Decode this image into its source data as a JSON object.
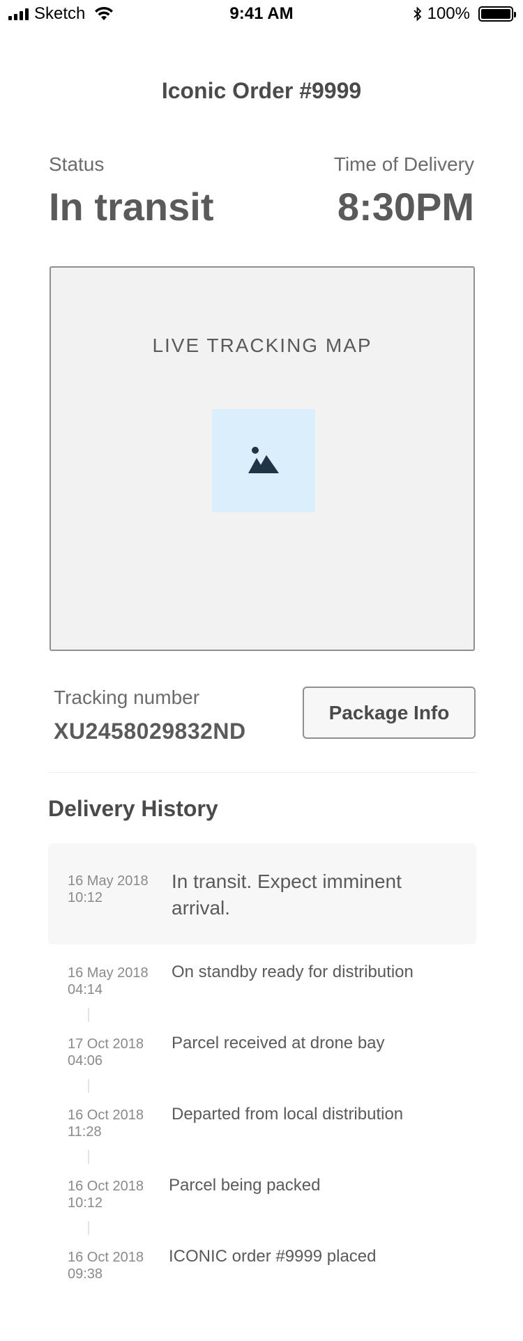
{
  "status_bar": {
    "carrier": "Sketch",
    "time": "9:41 AM",
    "battery": "100%"
  },
  "order": {
    "title": "Iconic Order #9999"
  },
  "status": {
    "label": "Status",
    "value": "In transit"
  },
  "delivery": {
    "label": "Time of Delivery",
    "value": "8:30PM"
  },
  "map": {
    "title": "LIVE TRACKING MAP",
    "icon": "image-placeholder-icon"
  },
  "tracking": {
    "label": "Tracking number",
    "number": "XU2458029832ND"
  },
  "package_button": {
    "label": "Package Info"
  },
  "history": {
    "title": "Delivery History",
    "items": [
      {
        "date": "16 May 2018",
        "time": "10:12",
        "text": "In transit. Expect imminent arrival."
      },
      {
        "date": "16 May 2018",
        "time": "04:14",
        "text": "On standby ready for distribution"
      },
      {
        "date": "17 Oct 2018",
        "time": "04:06",
        "text": "Parcel received at drone bay"
      },
      {
        "date": "16 Oct 2018",
        "time": "11:28",
        "text": "Departed from local distribution"
      },
      {
        "date": "16 Oct 2018",
        "time": "10:12",
        "text": "Parcel being packed"
      },
      {
        "date": "16 Oct 2018",
        "time": "09:38",
        "text": "ICONIC order #9999 placed"
      }
    ]
  },
  "colors": {
    "text": "#4a4a4a",
    "map_bg": "#f2f2f2",
    "placeholder_bg": "#daeefc",
    "icon": "#1f3446"
  }
}
